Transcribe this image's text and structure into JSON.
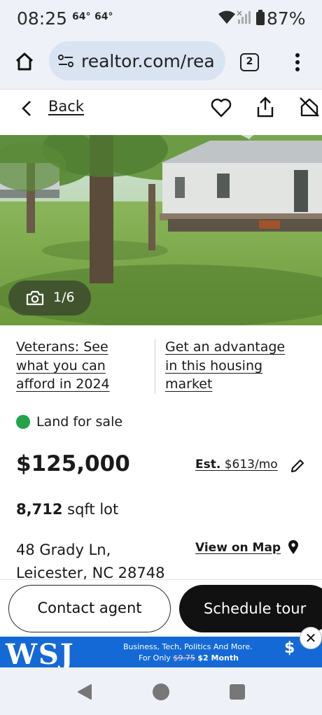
{
  "status_bar": {
    "time": "08:25",
    "temp1": "64°",
    "temp2": "64°",
    "battery": "87%"
  },
  "browser": {
    "url": "realtor.com/rea",
    "tab_count": "2"
  },
  "topbar": {
    "back_label": "Back"
  },
  "photo": {
    "counter": "1/6"
  },
  "promos": [
    {
      "lines": [
        "Veterans: See",
        "what you can",
        "afford in 2024"
      ]
    },
    {
      "lines": [
        "Get an advantage",
        "in this housing",
        "market"
      ]
    }
  ],
  "listing": {
    "status": "Land for sale",
    "status_color": "#22a447",
    "price": "$125,000",
    "est_label": "Est.",
    "est_value": "$613/mo",
    "lot_size": "8,712",
    "lot_unit": "sqft lot",
    "address_line1": "48 Grady Ln,",
    "address_line2": "Leicester, NC 28748",
    "view_map": "View on Map"
  },
  "actions": {
    "contact": "Contact agent",
    "tour": "Schedule tour"
  },
  "ad": {
    "logo": "WSJ",
    "line1": "Business, Tech, Politics And More.",
    "line2_prefix": "For Only",
    "old_price": "$9.75",
    "new_price": "$2 Month",
    "badge": "$",
    "close": "✕"
  }
}
